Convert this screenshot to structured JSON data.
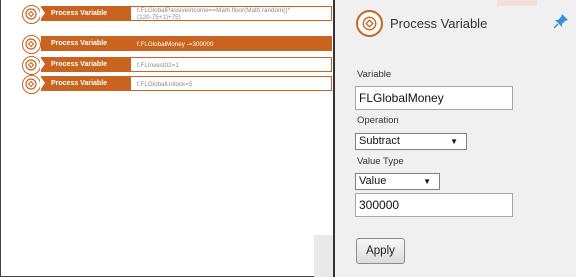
{
  "canvas": {
    "nodes": [
      {
        "label": "Process Variable",
        "code": "f.FLGlobalPassiveIncome==Math.floor(Math.random()*\n(120-75+1)+75)",
        "selected": false
      },
      {
        "label": "Process Variable",
        "code": "f.FLGlobalMoney -=300000",
        "selected": true
      },
      {
        "label": "Process Variable",
        "code": "f.FLInvest02=1",
        "selected": false
      },
      {
        "label": "Process Variable",
        "code": "f.FLGlobalUnlock=5",
        "selected": false
      }
    ]
  },
  "panel": {
    "title": "Process Variable",
    "variable_label": "Variable",
    "variable_value": "FLGlobalMoney",
    "operation_label": "Operation",
    "operation_value": "Subtract",
    "value_type_label": "Value Type",
    "value_type_value": "Value",
    "value_value": "300000",
    "apply_label": "Apply"
  },
  "icons": {
    "node_icon": "process-variable-icon",
    "pin": "pin-icon",
    "dropdown": "chevron-down-icon"
  },
  "colors": {
    "accent": "#c8641f",
    "pin": "#3a8fd8"
  }
}
